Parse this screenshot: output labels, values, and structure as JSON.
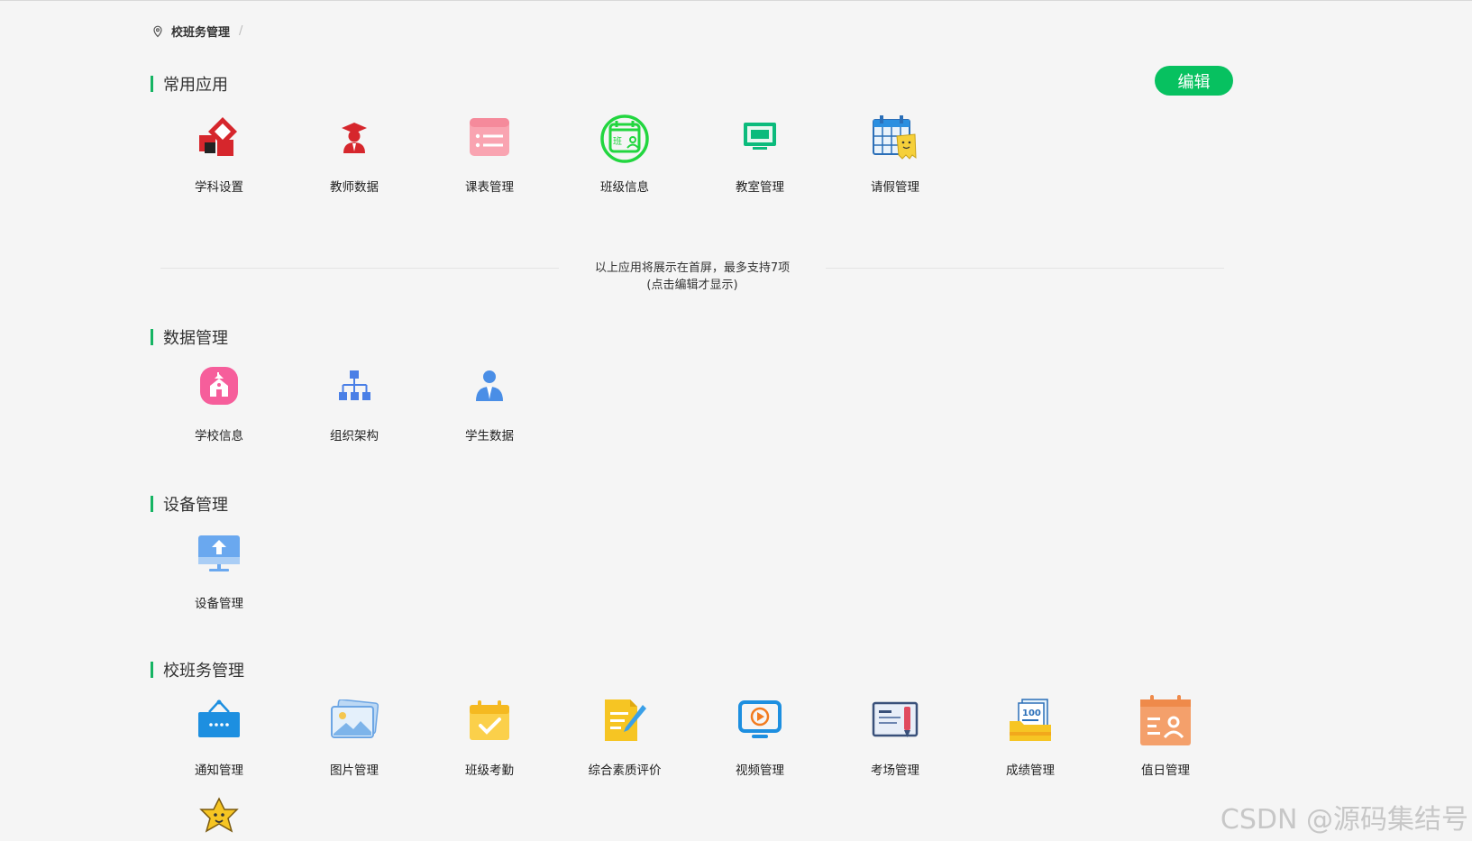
{
  "breadcrumb": {
    "item": "校班务管理",
    "separator": "/"
  },
  "common": {
    "title": "常用应用",
    "edit_label": "编辑",
    "apps": [
      {
        "label": "学科设置",
        "icon": "subject-settings-icon"
      },
      {
        "label": "教师数据",
        "icon": "teacher-data-icon"
      },
      {
        "label": "课表管理",
        "icon": "timetable-icon"
      },
      {
        "label": "班级信息",
        "icon": "class-info-icon"
      },
      {
        "label": "教室管理",
        "icon": "classroom-icon"
      },
      {
        "label": "请假管理",
        "icon": "leave-calendar-icon"
      }
    ],
    "hint_line1": "以上应用将展示在首屏，最多支持7项",
    "hint_line2": "(点击编辑才显示)"
  },
  "data_mgmt": {
    "title": "数据管理",
    "apps": [
      {
        "label": "学校信息",
        "icon": "school-icon"
      },
      {
        "label": "组织架构",
        "icon": "org-chart-icon"
      },
      {
        "label": "学生数据",
        "icon": "student-icon"
      }
    ]
  },
  "device_mgmt": {
    "title": "设备管理",
    "apps": [
      {
        "label": "设备管理",
        "icon": "device-monitor-icon"
      }
    ]
  },
  "school_mgmt": {
    "title": "校班务管理",
    "apps": [
      {
        "label": "通知管理",
        "icon": "notice-board-icon"
      },
      {
        "label": "图片管理",
        "icon": "picture-icon"
      },
      {
        "label": "班级考勤",
        "icon": "attendance-icon"
      },
      {
        "label": "综合素质评价",
        "icon": "evaluation-icon"
      },
      {
        "label": "视频管理",
        "icon": "video-icon"
      },
      {
        "label": "考场管理",
        "icon": "exam-room-icon"
      },
      {
        "label": "成绩管理",
        "icon": "score-icon"
      },
      {
        "label": "值日管理",
        "icon": "duty-icon"
      }
    ],
    "extra_icon": "star-mascot-icon"
  },
  "watermark": "CSDN @源码集结号",
  "colors": {
    "accent": "#07c160",
    "section_bar": "#16b463"
  }
}
